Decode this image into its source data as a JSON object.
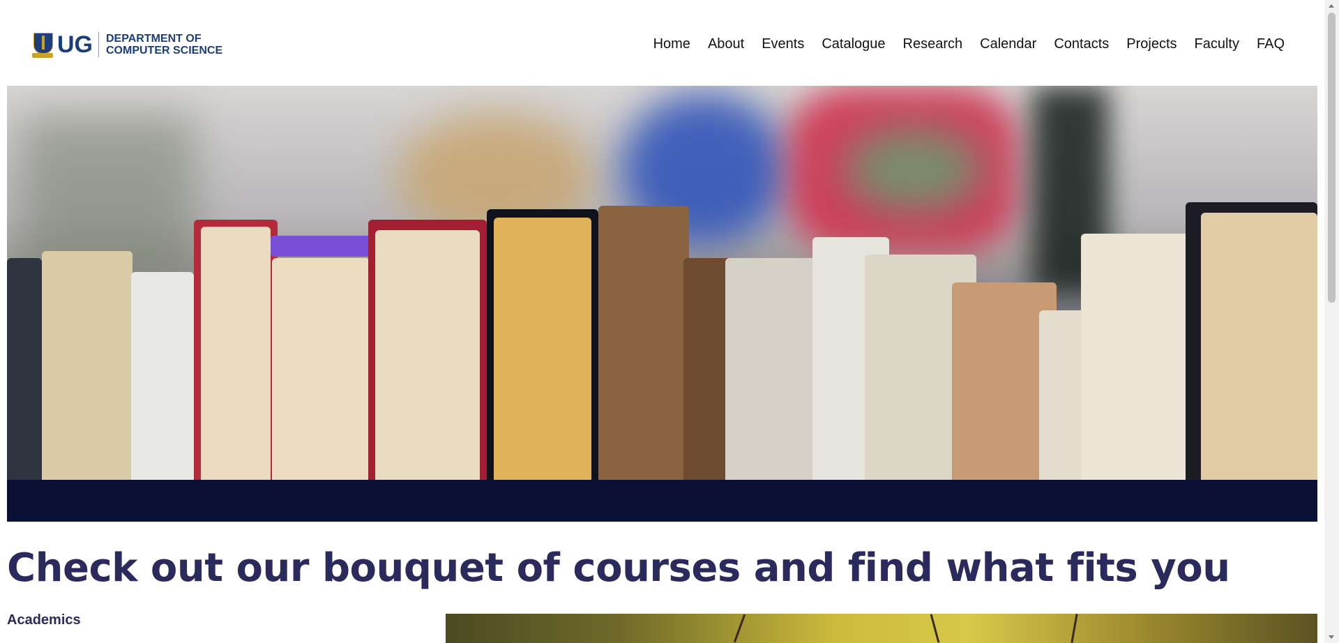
{
  "logo": {
    "short": "UG",
    "line1": "DEPARTMENT OF",
    "line2": "COMPUTER SCIENCE"
  },
  "nav": [
    {
      "label": "Home"
    },
    {
      "label": "About"
    },
    {
      "label": "Events"
    },
    {
      "label": "Catalogue"
    },
    {
      "label": "Research"
    },
    {
      "label": "Calendar"
    },
    {
      "label": "Contacts"
    },
    {
      "label": "Projects"
    },
    {
      "label": "Faculty"
    },
    {
      "label": "FAQ"
    }
  ],
  "main": {
    "headline": "Check out our bouquet of courses and find what fits you",
    "section_label": "Academics"
  },
  "colors": {
    "brand": "#1b3e7b",
    "headline": "#2b2a5c"
  }
}
